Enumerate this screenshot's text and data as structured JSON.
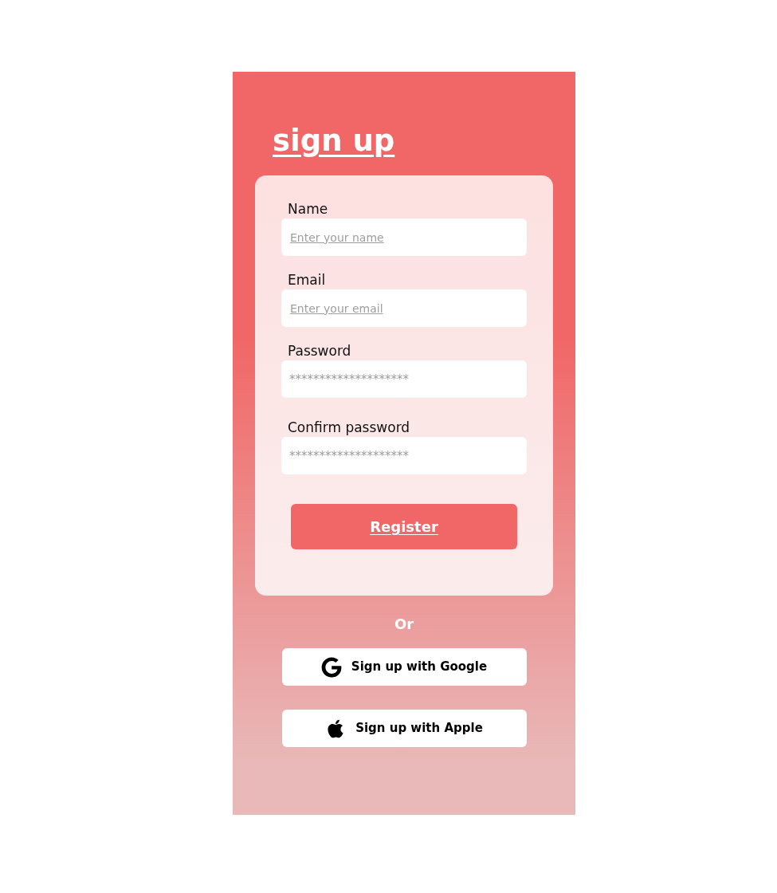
{
  "title": "sign up",
  "form": {
    "fields": [
      {
        "label": "Name",
        "placeholder": "Enter your name",
        "kind": "text"
      },
      {
        "label": "Email",
        "placeholder": "Enter your email",
        "kind": "text"
      },
      {
        "label": "Password",
        "placeholder": "********************",
        "kind": "password"
      },
      {
        "label": "Confirm password",
        "placeholder": "********************",
        "kind": "password"
      }
    ],
    "submit": "Register"
  },
  "divider": "Or",
  "social_buttons": [
    {
      "label": "Sign up with Google",
      "kind": "google"
    },
    {
      "label": "Sign up with Apple",
      "kind": "apple"
    }
  ]
}
